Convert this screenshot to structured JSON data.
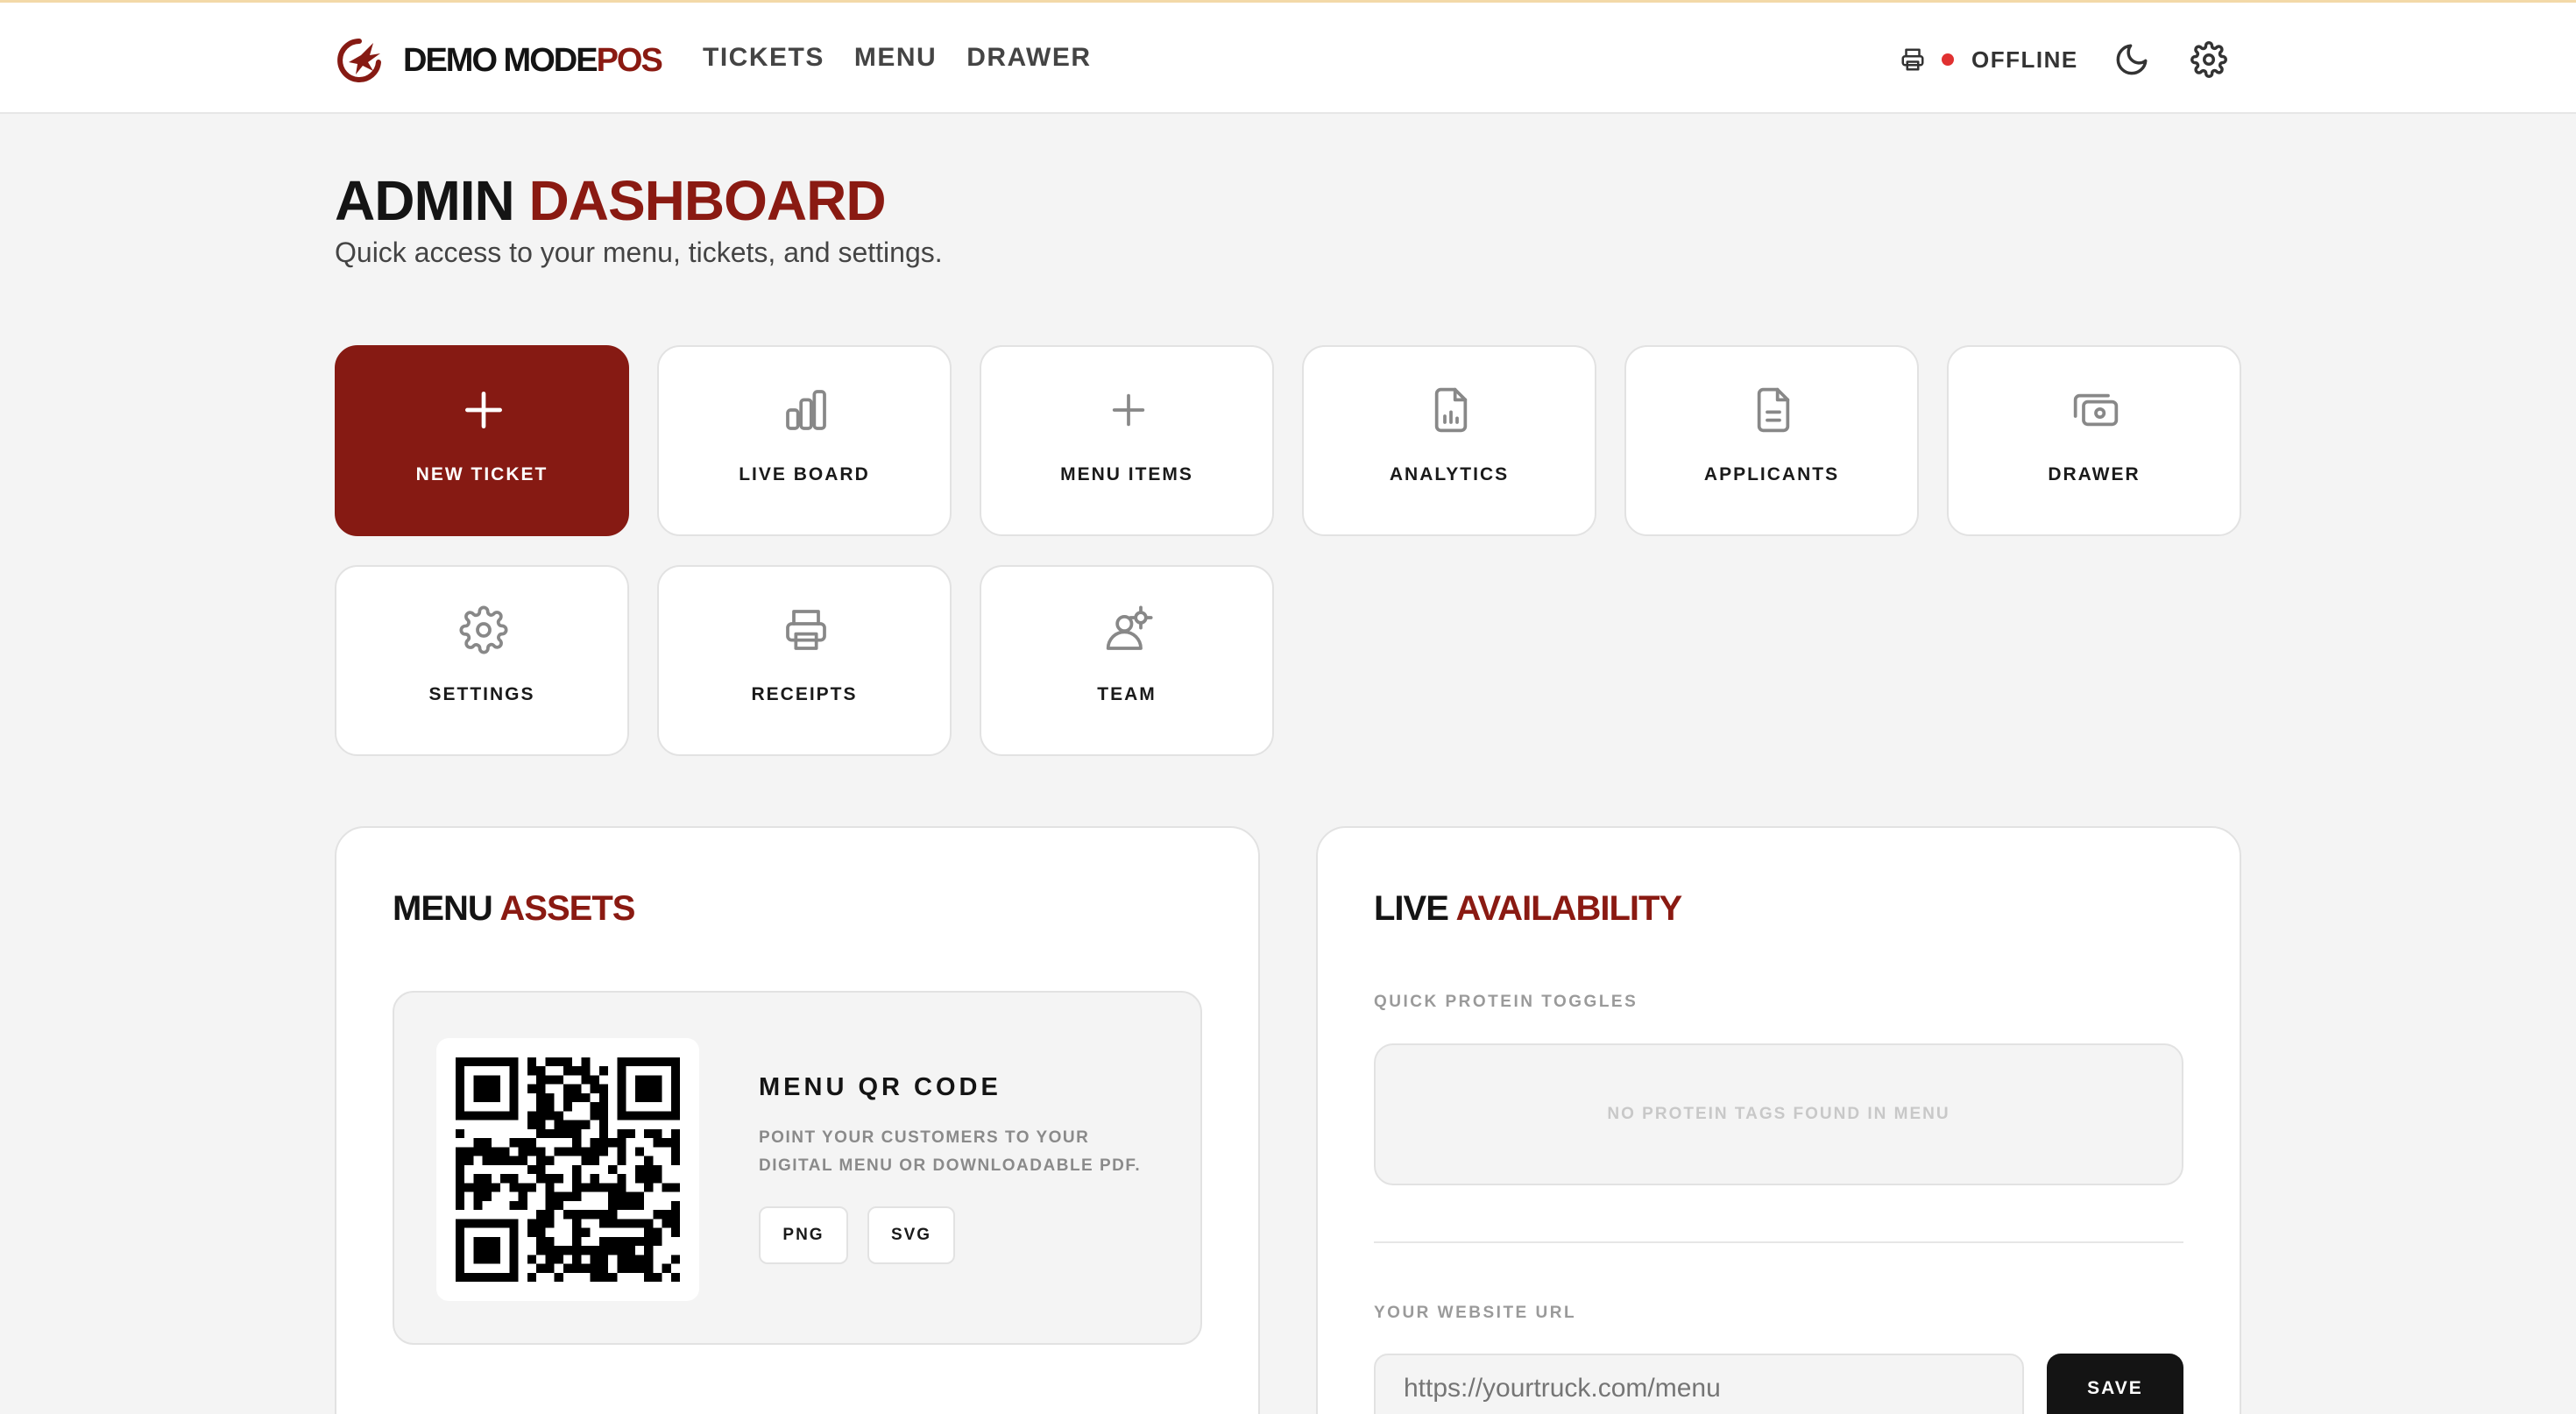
{
  "brand": {
    "part1": "DEMO MODE",
    "part2": "POS"
  },
  "nav": [
    "TICKETS",
    "MENU",
    "DRAWER"
  ],
  "status": {
    "label": "OFFLINE",
    "color": "#e03131"
  },
  "header": {
    "title_part1": "ADMIN",
    "title_part2": "DASHBOARD",
    "subtitle": "Quick access to your menu, tickets, and settings."
  },
  "tiles": [
    {
      "label": "NEW TICKET",
      "icon": "plus-icon"
    },
    {
      "label": "LIVE BOARD",
      "icon": "bar-chart-icon"
    },
    {
      "label": "MENU ITEMS",
      "icon": "plus-icon"
    },
    {
      "label": "ANALYTICS",
      "icon": "file-chart-icon"
    },
    {
      "label": "APPLICANTS",
      "icon": "file-text-icon"
    },
    {
      "label": "DRAWER",
      "icon": "cash-icon"
    },
    {
      "label": "SETTINGS",
      "icon": "gear-icon"
    },
    {
      "label": "RECEIPTS",
      "icon": "printer-icon"
    },
    {
      "label": "TEAM",
      "icon": "team-icon"
    }
  ],
  "menu_assets": {
    "title_part1": "MENU",
    "title_part2": "ASSETS",
    "qr_title": "MENU QR CODE",
    "qr_desc": "POINT YOUR CUSTOMERS TO YOUR DIGITAL MENU OR DOWNLOADABLE PDF.",
    "png_label": "PNG",
    "svg_label": "SVG"
  },
  "live_availability": {
    "title_part1": "LIVE",
    "title_part2": "AVAILABILITY",
    "toggles_label": "QUICK PROTEIN TOGGLES",
    "empty_text": "NO PROTEIN TAGS FOUND IN MENU",
    "url_label": "YOUR WEBSITE URL",
    "url_placeholder": "https://yourtruck.com/menu",
    "save_label": "SAVE"
  },
  "colors": {
    "accent": "#861a13",
    "dark": "#141414",
    "background": "#f4f4f4"
  }
}
